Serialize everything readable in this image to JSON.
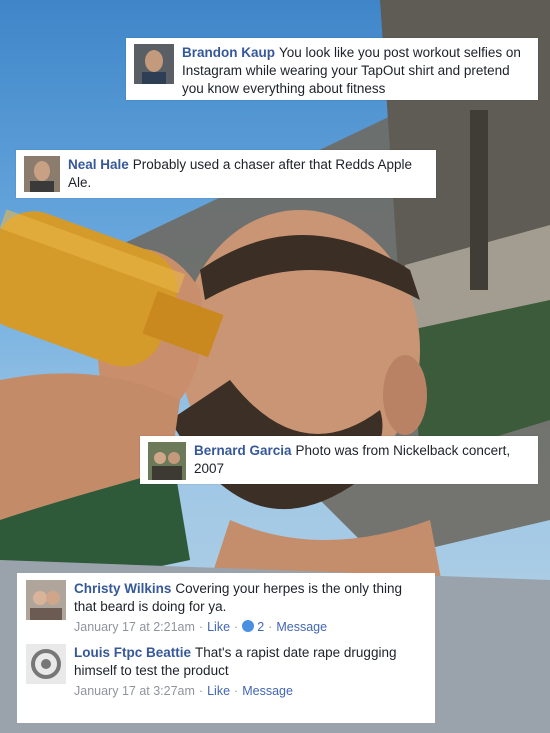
{
  "comments": {
    "c1": {
      "author": "Brandon Kaup",
      "text": "You look like you post workout selfies on Instagram while wearing your TapOut shirt and pretend you know everything about fitness"
    },
    "c2": {
      "author": "Neal Hale",
      "text": "Probably used a chaser after that Redds Apple Ale."
    },
    "c3": {
      "author": "Bernard Garcia",
      "text": "Photo was from Nickelback concert, 2007"
    },
    "c4": {
      "author": "Christy Wilkins",
      "text": "Covering your herpes is the only thing that beard is doing for ya.",
      "time": "January 17 at 2:21am",
      "like_label": "Like",
      "reaction_count": "2",
      "message_label": "Message"
    },
    "c5": {
      "author": "Louis Ftpc Beattie",
      "text": "That's a rapist date rape drugging himself to test the product",
      "time": "January 17 at 3:27am",
      "like_label": "Like",
      "message_label": "Message"
    }
  },
  "colors": {
    "name_blue": "#365899",
    "link_blue": "#4267b2",
    "meta_gray": "#90949c",
    "reaction_blue": "#4a90e2"
  }
}
